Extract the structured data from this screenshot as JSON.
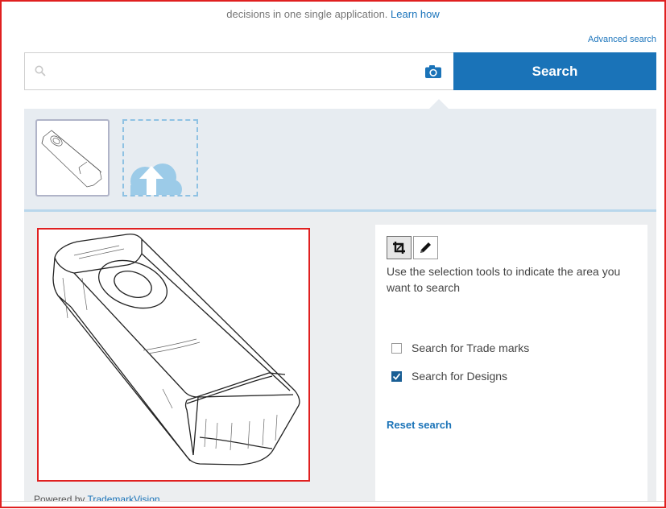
{
  "header": {
    "intro_text": "decisions in one single application.",
    "learn_link": "Learn how",
    "advanced_link": "Advanced search"
  },
  "search": {
    "placeholder": "",
    "button_label": "Search"
  },
  "icons": {
    "search": "magnifier-icon",
    "camera": "camera-icon",
    "upload": "cloud-upload-icon",
    "crop": "crop-icon",
    "pencil": "pencil-icon"
  },
  "tools": {
    "instructions": "Use the selection tools to indicate the area you want to search",
    "checkboxes": [
      {
        "label": "Search for Trade marks",
        "checked": false
      },
      {
        "label": "Search for Designs",
        "checked": true
      }
    ],
    "reset_label": "Reset search"
  },
  "footer": {
    "powered_prefix": "Powered by",
    "powered_link": "TrademarkVision"
  },
  "colors": {
    "primary": "#1a73b8",
    "highlight_border": "#e02020",
    "panel_bg": "#e7ecf1"
  }
}
